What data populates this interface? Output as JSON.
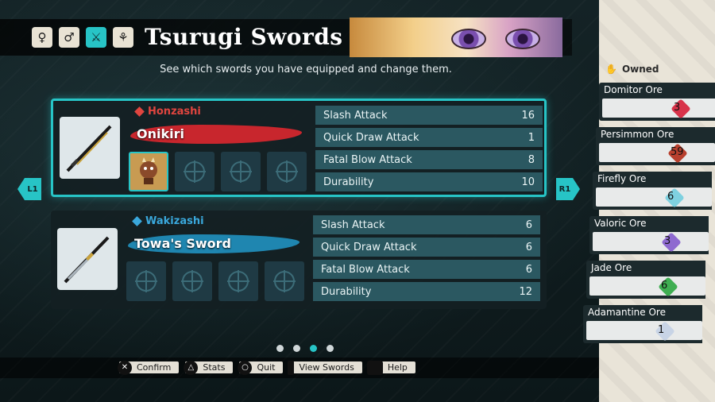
{
  "header": {
    "title": "Tsurugi Swords",
    "subtitle": "See which swords you have equipped and change them.",
    "icons": [
      "figure-icon",
      "figures-icon",
      "swords-icon",
      "paw-icon"
    ]
  },
  "colors": {
    "accent": "#27c4c6",
    "honzashi": "#e0453f",
    "wakizashi": "#3aa8dc"
  },
  "cards": [
    {
      "type": "Honzashi",
      "name": "Onikiri",
      "stats": [
        {
          "label": "Slash Attack",
          "value": "16"
        },
        {
          "label": "Quick Draw Attack",
          "value": "1"
        },
        {
          "label": "Fatal Blow Attack",
          "value": "8"
        },
        {
          "label": "Durability",
          "value": "10"
        }
      ]
    },
    {
      "type": "Wakizashi",
      "name": "Towa's Sword",
      "stats": [
        {
          "label": "Slash Attack",
          "value": "6"
        },
        {
          "label": "Quick Draw Attack",
          "value": "6"
        },
        {
          "label": "Fatal Blow Attack",
          "value": "6"
        },
        {
          "label": "Durability",
          "value": "12"
        }
      ]
    }
  ],
  "nav": {
    "left": "L1",
    "right": "R1"
  },
  "pagination": {
    "count": 4,
    "active": 3
  },
  "prompts": {
    "confirm": "Confirm",
    "stats": "Stats",
    "quit": "Quit",
    "view_swords": "View Swords",
    "help": "Help"
  },
  "inventory": {
    "heading": "Owned",
    "ores": [
      {
        "name": "Domitor Ore",
        "count": "3",
        "color": "#d8334a"
      },
      {
        "name": "Persimmon Ore",
        "count": "59",
        "color": "#b8402e"
      },
      {
        "name": "Firefly Ore",
        "count": "6",
        "color": "#7fd1e0"
      },
      {
        "name": "Valoric Ore",
        "count": "3",
        "color": "#8e6ad0"
      },
      {
        "name": "Jade Ore",
        "count": "6",
        "color": "#3fae52"
      },
      {
        "name": "Adamantine Ore",
        "count": "1",
        "color": "#c8d4e6"
      }
    ]
  }
}
